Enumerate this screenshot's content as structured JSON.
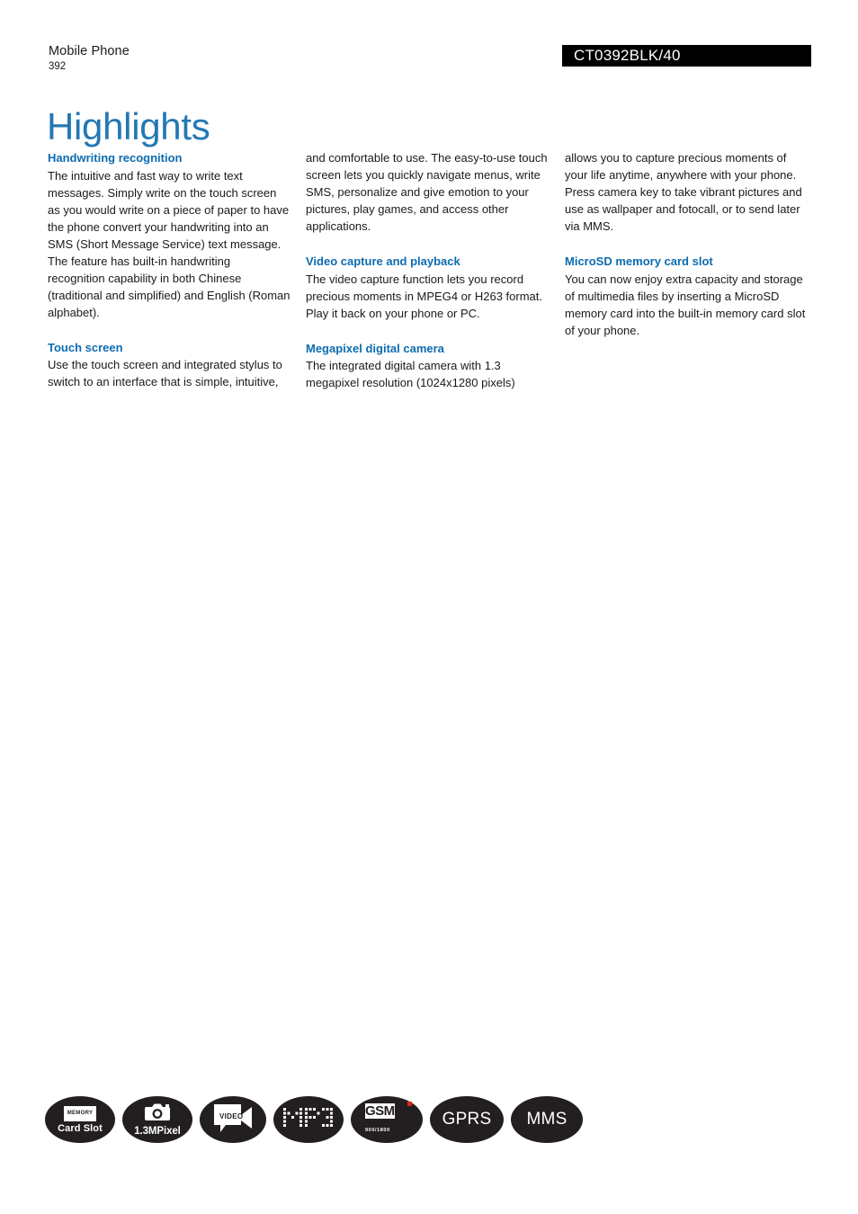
{
  "header": {
    "category": "Mobile Phone",
    "page_number": "392",
    "product_code": "CT0392BLK/40",
    "code_bar_color": "#000000"
  },
  "title": "Highlights",
  "title_color": "#2478b4",
  "heading_color": "#0d6cb0",
  "columns": [
    {
      "name": "column-1",
      "sections": [
        {
          "heading": "Handwriting recognition",
          "body": "The intuitive and fast way to write text messages. Simply write on the touch screen as you would write on a piece of paper to have the phone convert your handwriting into an SMS (Short Message Service) text message. The feature has built-in handwriting recognition capability in both Chinese (traditional and simplified) and English (Roman alphabet)."
        },
        {
          "heading": "Touch screen",
          "body": "Use the touch screen and integrated stylus to switch to an interface that is simple, intuitive,"
        }
      ]
    },
    {
      "name": "column-2",
      "continuation": "and comfortable to use. The easy-to-use touch screen lets you quickly navigate menus, write SMS, personalize and give emotion to your pictures, play games, and access other applications.",
      "sections": [
        {
          "heading": "Video capture and playback",
          "body": "The video capture function lets you record precious moments in MPEG4 or H263 format. Play it back on your phone or PC."
        },
        {
          "heading": "Megapixel digital camera",
          "body": "The integrated digital camera with 1.3 megapixel resolution (1024x1280 pixels)"
        }
      ]
    },
    {
      "name": "column-3",
      "continuation": "allows you to capture precious moments of your life anytime, anywhere with your phone. Press camera key to take vibrant pictures and use as wallpaper and fotocall, or to send later via MMS.",
      "sections": [
        {
          "heading": "MicroSD memory card slot",
          "body": "You can now enjoy extra capacity and storage of multimedia files by inserting a MicroSD memory card into the built-in memory card slot of your phone."
        }
      ]
    }
  ],
  "badges": [
    {
      "id": "memory-card-slot",
      "chip_text": "MEMORY",
      "label": "Card Slot"
    },
    {
      "id": "camera",
      "icon": "camera-icon",
      "label": "1.3MPixel"
    },
    {
      "id": "video",
      "icon": "camcorder-icon",
      "label": "VIDEO"
    },
    {
      "id": "mp3",
      "label": "MP3"
    },
    {
      "id": "gsm",
      "label": "GSM",
      "band": "900/1800",
      "dot_color": "#e2231a"
    },
    {
      "id": "gprs",
      "label": "GPRS"
    },
    {
      "id": "mms",
      "label": "MMS"
    }
  ],
  "badge_background": "#231f20"
}
